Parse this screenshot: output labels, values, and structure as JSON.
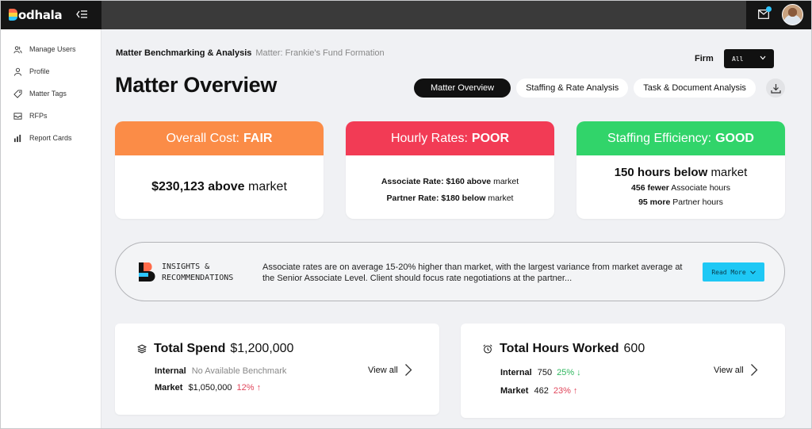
{
  "brand": {
    "logo_rest": "odhala"
  },
  "sidebar": {
    "items": [
      {
        "label": "Manage Users",
        "icon": "users-icon"
      },
      {
        "label": "Profile",
        "icon": "user-icon"
      },
      {
        "label": "Matter Tags",
        "icon": "tag-icon"
      },
      {
        "label": "RFPs",
        "icon": "inbox-icon"
      },
      {
        "label": "Report Cards",
        "icon": "bar-chart-icon"
      }
    ]
  },
  "breadcrumb": {
    "main": "Matter Benchmarking & Analysis",
    "sub": "Matter: Frankie's Fund Formation"
  },
  "firm": {
    "label": "Firm",
    "selected": "All"
  },
  "page_title": "Matter Overview",
  "tabs": [
    {
      "label": "Matter Overview",
      "active": true
    },
    {
      "label": "Staffing & Rate Analysis",
      "active": false
    },
    {
      "label": "Task & Document Analysis",
      "active": false
    }
  ],
  "rating_cards": {
    "cost": {
      "title": "Overall Cost:",
      "rating": "FAIR",
      "value": "$230,123",
      "value_strong": "above",
      "value_rest": "market",
      "color": "#fb8c47"
    },
    "rates": {
      "title": "Hourly Rates:",
      "rating": "POOR",
      "color": "#f23b55",
      "associate_label": "Associate Rate: $160 above",
      "associate_rest": "market",
      "partner_label": "Partner Rate: $180 below",
      "partner_rest": "market"
    },
    "staffing": {
      "title": "Staffing Efficiency:",
      "rating": "GOOD",
      "color": "#31d46a",
      "line1_strong": "150 hours below",
      "line1_rest": "market",
      "line2_strong": "456 fewer",
      "line2_rest": "Associate hours",
      "line3_strong": "95 more",
      "line3_rest": "Partner hours"
    }
  },
  "insights": {
    "label_line1": "INSIGHTS &",
    "label_line2": "RECOMMENDATIONS",
    "text": "Associate rates are on average 15-20% higher than market, with the largest variance from market average at the Senior Associate Level. Client should focus rate negotiations at the partner...",
    "read_more": "Read More"
  },
  "total_spend": {
    "title": "Total Spend",
    "amount": "$1,200,000",
    "internal_label": "Internal",
    "internal_value": "No Available Benchmark",
    "market_label": "Market",
    "market_value": "$1,050,000",
    "market_delta": "12% ↑",
    "view_all": "View all"
  },
  "total_hours": {
    "title": "Total Hours Worked",
    "amount": "600",
    "internal_label": "Internal",
    "internal_value": "750",
    "internal_delta": "25% ↓",
    "market_label": "Market",
    "market_value": "462",
    "market_delta": "23% ↑",
    "view_all": "View all"
  }
}
